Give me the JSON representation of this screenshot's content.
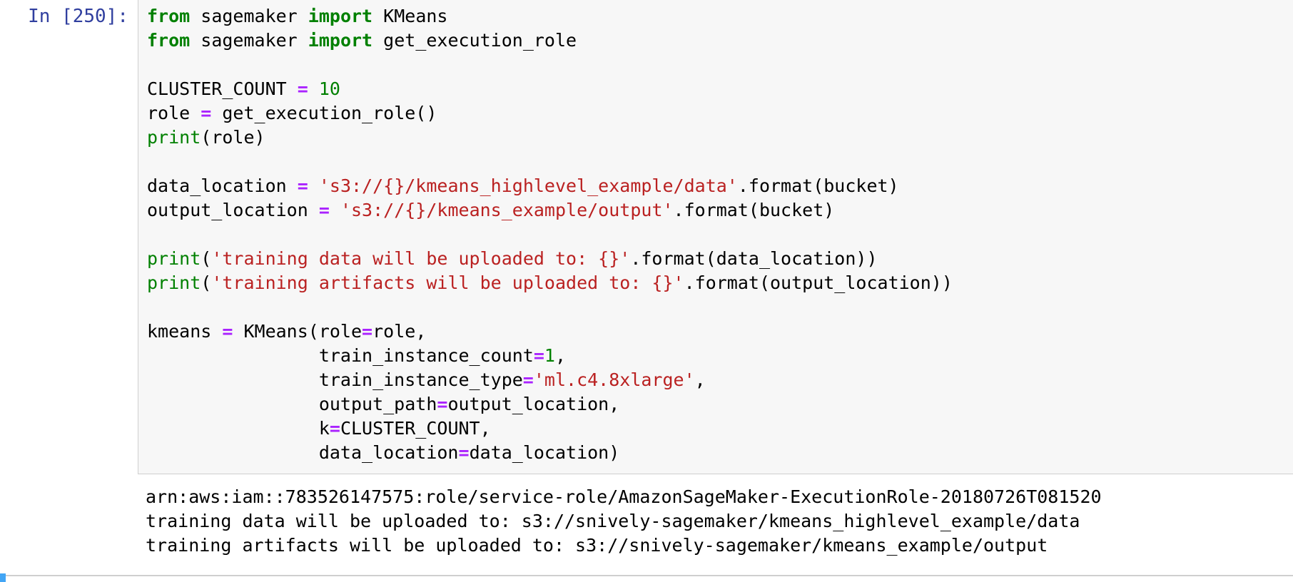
{
  "cell": {
    "prompt": "In [250]:",
    "code_lines": [
      [
        {
          "t": "from",
          "c": "kw"
        },
        {
          "t": " sagemaker ",
          "c": ""
        },
        {
          "t": "import",
          "c": "kw"
        },
        {
          "t": " KMeans",
          "c": ""
        }
      ],
      [
        {
          "t": "from",
          "c": "kw"
        },
        {
          "t": " sagemaker ",
          "c": ""
        },
        {
          "t": "import",
          "c": "kw"
        },
        {
          "t": " get_execution_role",
          "c": ""
        }
      ],
      [],
      [
        {
          "t": "CLUSTER_COUNT ",
          "c": ""
        },
        {
          "t": "=",
          "c": "op"
        },
        {
          "t": " ",
          "c": ""
        },
        {
          "t": "10",
          "c": "num"
        }
      ],
      [
        {
          "t": "role ",
          "c": ""
        },
        {
          "t": "=",
          "c": "op"
        },
        {
          "t": " get_execution_role()",
          "c": ""
        }
      ],
      [
        {
          "t": "print",
          "c": "bi"
        },
        {
          "t": "(role)",
          "c": ""
        }
      ],
      [],
      [
        {
          "t": "data_location ",
          "c": ""
        },
        {
          "t": "=",
          "c": "op"
        },
        {
          "t": " ",
          "c": ""
        },
        {
          "t": "'s3://{}/kmeans_highlevel_example/data'",
          "c": "str"
        },
        {
          "t": ".format(bucket)",
          "c": ""
        }
      ],
      [
        {
          "t": "output_location ",
          "c": ""
        },
        {
          "t": "=",
          "c": "op"
        },
        {
          "t": " ",
          "c": ""
        },
        {
          "t": "'s3://{}/kmeans_example/output'",
          "c": "str"
        },
        {
          "t": ".format(bucket)",
          "c": ""
        }
      ],
      [],
      [
        {
          "t": "print",
          "c": "bi"
        },
        {
          "t": "(",
          "c": ""
        },
        {
          "t": "'training data will be uploaded to: {}'",
          "c": "str"
        },
        {
          "t": ".format(data_location))",
          "c": ""
        }
      ],
      [
        {
          "t": "print",
          "c": "bi"
        },
        {
          "t": "(",
          "c": ""
        },
        {
          "t": "'training artifacts will be uploaded to: {}'",
          "c": "str"
        },
        {
          "t": ".format(output_location))",
          "c": ""
        }
      ],
      [],
      [
        {
          "t": "kmeans ",
          "c": ""
        },
        {
          "t": "=",
          "c": "op"
        },
        {
          "t": " KMeans(role",
          "c": ""
        },
        {
          "t": "=",
          "c": "op"
        },
        {
          "t": "role,",
          "c": ""
        }
      ],
      [
        {
          "t": "                train_instance_count",
          "c": ""
        },
        {
          "t": "=",
          "c": "op"
        },
        {
          "t": "1",
          "c": "num"
        },
        {
          "t": ",",
          "c": ""
        }
      ],
      [
        {
          "t": "                train_instance_type",
          "c": ""
        },
        {
          "t": "=",
          "c": "op"
        },
        {
          "t": "'ml.c4.8xlarge'",
          "c": "str"
        },
        {
          "t": ",",
          "c": ""
        }
      ],
      [
        {
          "t": "                output_path",
          "c": ""
        },
        {
          "t": "=",
          "c": "op"
        },
        {
          "t": "output_location,",
          "c": ""
        }
      ],
      [
        {
          "t": "                k",
          "c": ""
        },
        {
          "t": "=",
          "c": "op"
        },
        {
          "t": "CLUSTER_COUNT,",
          "c": ""
        }
      ],
      [
        {
          "t": "                data_location",
          "c": ""
        },
        {
          "t": "=",
          "c": "op"
        },
        {
          "t": "data_location)",
          "c": ""
        }
      ]
    ],
    "output_lines": [
      "arn:aws:iam::783526147575:role/service-role/AmazonSageMaker-ExecutionRole-20180726T081520",
      "training data will be uploaded to: s3://snively-sagemaker/kmeans_highlevel_example/data",
      "training artifacts will be uploaded to: s3://snively-sagemaker/kmeans_example/output"
    ]
  },
  "colors": {
    "prompt": "#303f9f",
    "keyword": "#008000",
    "operator": "#aa22ff",
    "string": "#ba2121",
    "code_bg": "#f7f7f7",
    "accent": "#42a5f5"
  }
}
